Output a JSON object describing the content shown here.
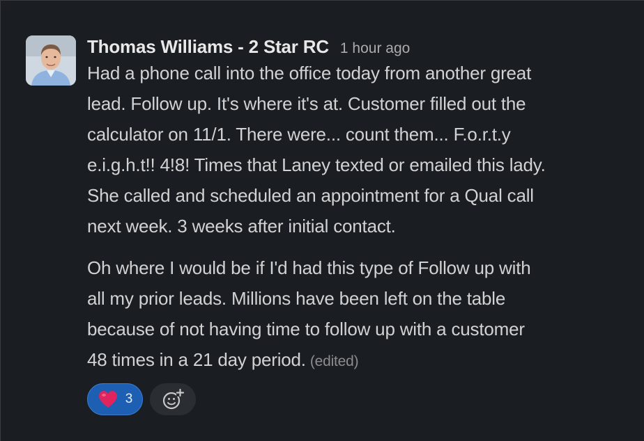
{
  "message": {
    "author": "Thomas Williams - 2 Star RC",
    "timestamp": "1 hour ago",
    "paragraphs": [
      [
        "Had a phone call into the office today from another great",
        "lead. Follow up. It's where it's at. Customer filled out the",
        "calculator on 11/1. There were... count them... F.o.r.t.y",
        "e.i.g.h.t!! 4!8! Times that Laney texted or emailed this lady.",
        "She called and scheduled an appointment for a Qual call",
        "next week. 3 weeks after initial contact."
      ],
      [
        "Oh where I would be if I'd had this type of Follow up with",
        "all my prior leads. Millions have been left on the table",
        "because of not having time to follow up with a customer",
        "48 times in a 21 day period."
      ]
    ],
    "edited_label": "(edited)"
  },
  "reactions": [
    {
      "emoji_icon": "red-heart-icon",
      "count": "3"
    }
  ],
  "add_reaction_icon": "add-emoji-icon",
  "colors": {
    "background": "#1a1d21",
    "reaction_active": "#1d5fb3",
    "heart": "#e0245e"
  }
}
